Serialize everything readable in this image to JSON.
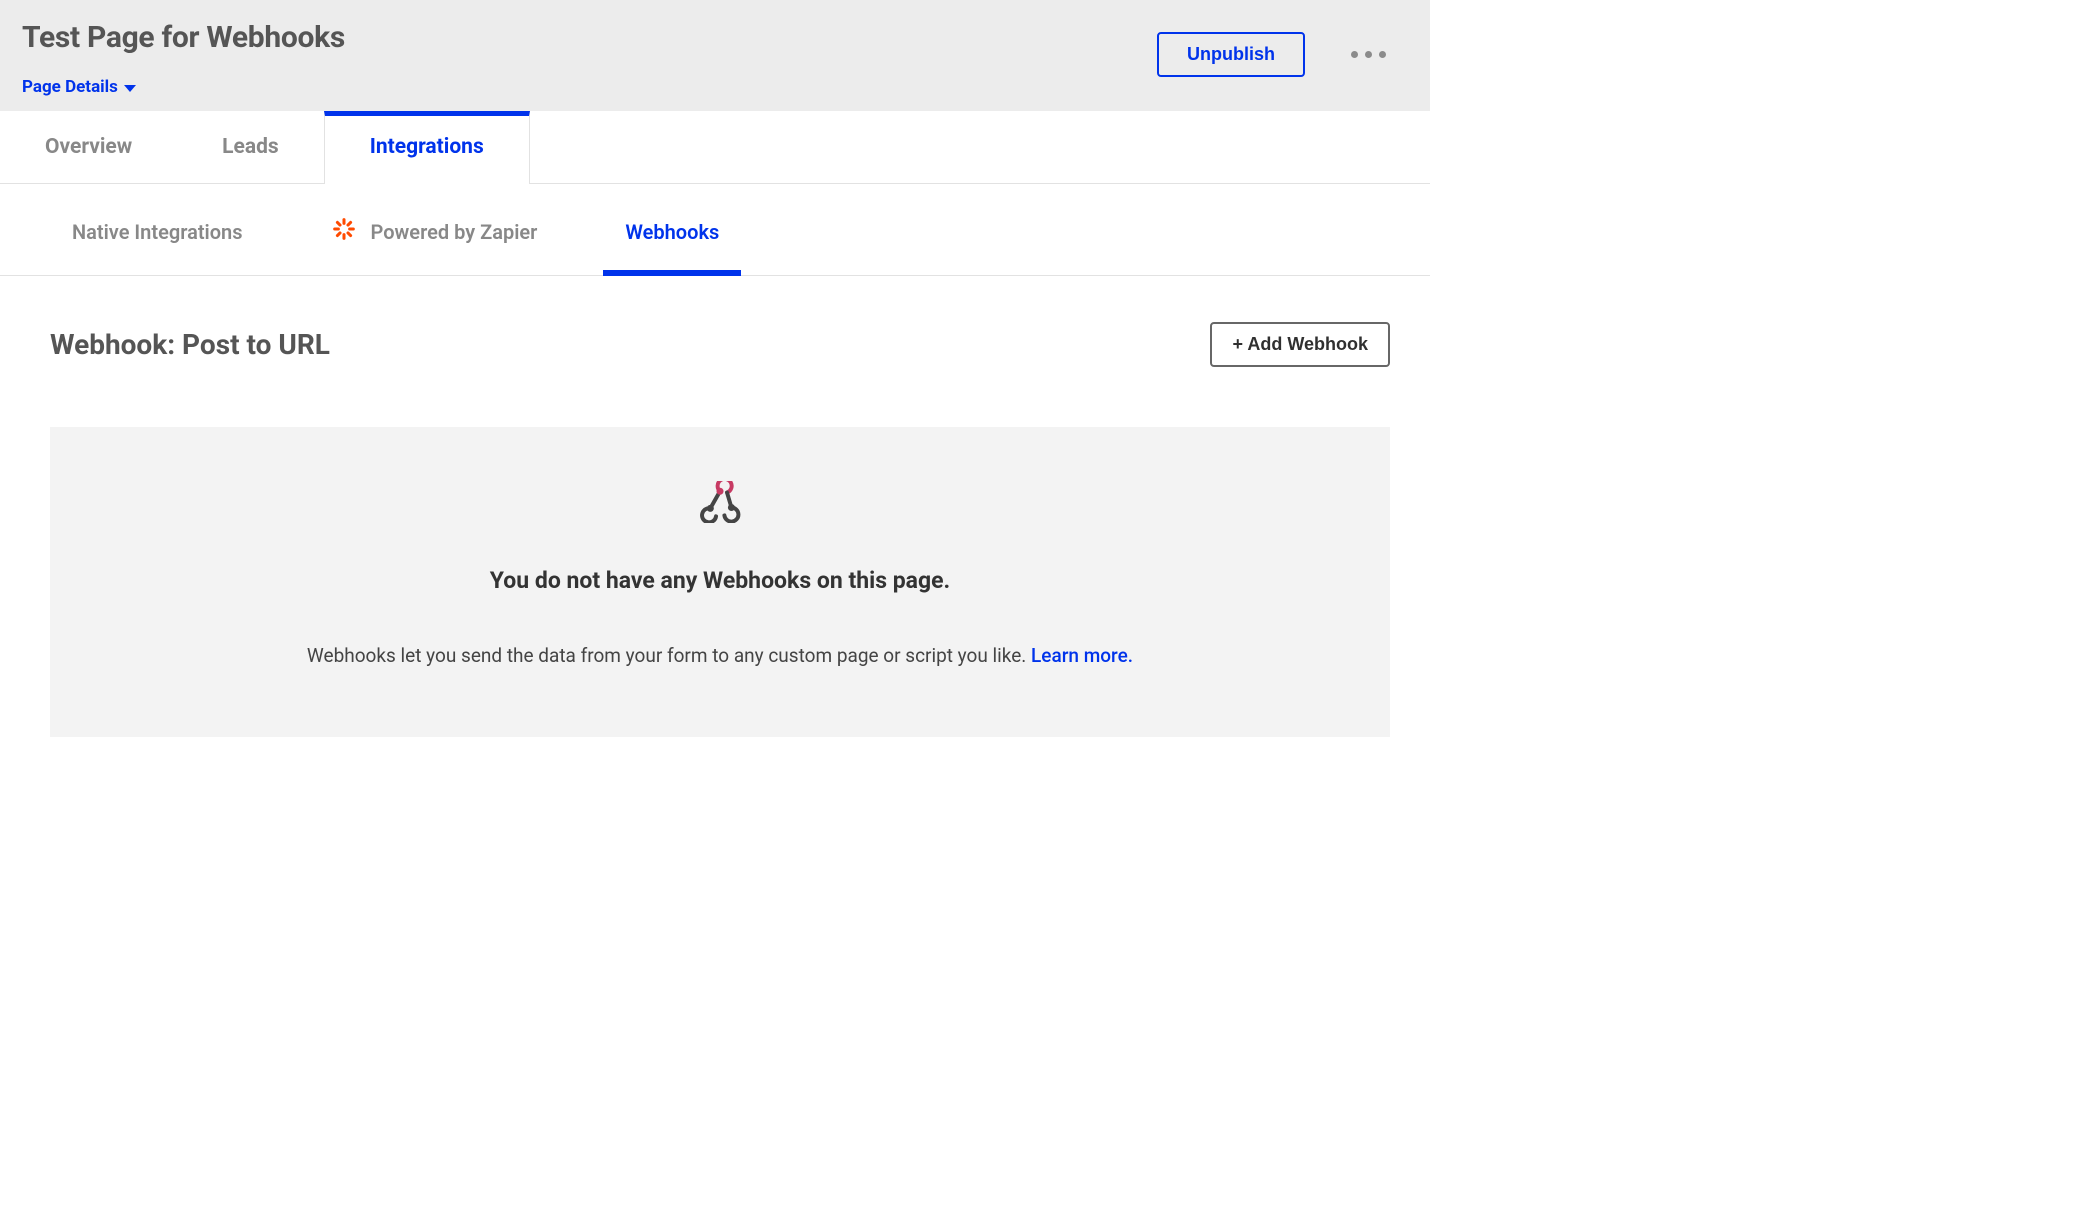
{
  "colors": {
    "primary": "#0033eb",
    "zapier": "#ff4a00",
    "webhook_accent": "#c73a63"
  },
  "header": {
    "title": "Test Page for Webhooks",
    "page_details_label": "Page Details",
    "unpublish_label": "Unpublish"
  },
  "tabs": [
    {
      "label": "Overview",
      "active": false
    },
    {
      "label": "Leads",
      "active": false
    },
    {
      "label": "Integrations",
      "active": true
    }
  ],
  "subtabs": [
    {
      "label": "Native Integrations",
      "active": false
    },
    {
      "label": "Powered by Zapier",
      "active": false,
      "icon": "zapier-icon"
    },
    {
      "label": "Webhooks",
      "active": true
    }
  ],
  "section": {
    "title": "Webhook: Post to URL",
    "add_button_label": "+ Add Webhook"
  },
  "empty_state": {
    "heading": "You do not have any Webhooks on this page.",
    "description": "Webhooks let you send the data from your form to any custom page or script you like. ",
    "learn_more_label": "Learn more."
  }
}
